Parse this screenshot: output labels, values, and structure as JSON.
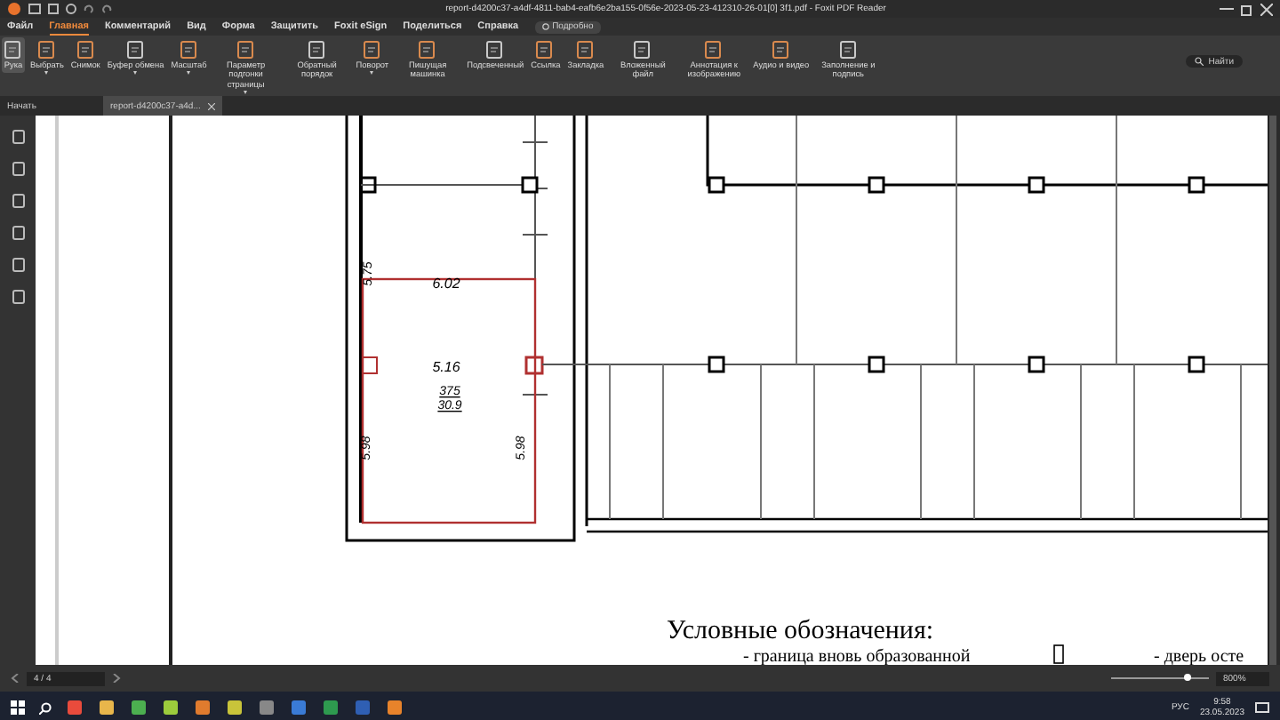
{
  "window": {
    "title": "report-d4200c37-a4df-4811-bab4-eafb6e2ba155-0f56e-2023-05-23-412310-26-01[0] 3f1.pdf - Foxit PDF Reader"
  },
  "menu_tabs": [
    {
      "label": "Файл",
      "selected": false
    },
    {
      "label": "Главная",
      "selected": true
    },
    {
      "label": "Комментарий",
      "selected": false
    },
    {
      "label": "Вид",
      "selected": false
    },
    {
      "label": "Форма",
      "selected": false
    },
    {
      "label": "Защитить",
      "selected": false
    },
    {
      "label": "Foxit eSign",
      "selected": false
    },
    {
      "label": "Поделиться",
      "selected": false
    },
    {
      "label": "Справка",
      "selected": false
    }
  ],
  "tell_me": {
    "placeholder": "Подробно"
  },
  "ribbon": [
    {
      "label": "Рука",
      "dropdown": false,
      "selected": true
    },
    {
      "label": "Выбрать",
      "dropdown": true,
      "selected": false
    },
    {
      "label": "Снимок",
      "dropdown": false,
      "selected": false
    },
    {
      "label": "Буфер обмена",
      "dropdown": true,
      "selected": false
    },
    {
      "label": "Масштаб",
      "dropdown": true,
      "selected": false
    },
    {
      "label": "Параметр подгонки страницы",
      "dropdown": true,
      "selected": false
    },
    {
      "label": "Обратный порядок",
      "dropdown": false,
      "selected": false
    },
    {
      "label": "Поворот",
      "dropdown": true,
      "selected": false
    },
    {
      "label": "Пишущая машинка",
      "dropdown": false,
      "selected": false
    },
    {
      "label": "Подсвеченный",
      "dropdown": false,
      "selected": false
    },
    {
      "label": "Ссылка",
      "dropdown": false,
      "selected": false
    },
    {
      "label": "Закладка",
      "dropdown": false,
      "selected": false
    },
    {
      "label": "Вложенный файл",
      "dropdown": false,
      "selected": false
    },
    {
      "label": "Аннотация к изображению",
      "dropdown": false,
      "selected": false
    },
    {
      "label": "Аудио и видео",
      "dropdown": false,
      "selected": false
    },
    {
      "label": "Заполнение и подпись",
      "dropdown": false,
      "selected": false
    }
  ],
  "find": {
    "placeholder": "Найти"
  },
  "doc_tabs": [
    {
      "label": "Начать",
      "selected": false,
      "closable": false
    },
    {
      "label": "report-d4200c37-a4d...",
      "selected": true,
      "closable": true
    }
  ],
  "plan": {
    "labels": [
      {
        "kind": "vertical",
        "text": "5.75"
      },
      {
        "kind": "horizontal",
        "text": "6.02"
      },
      {
        "kind": "horizontal",
        "text": "5.16"
      },
      {
        "kind": "area",
        "text": "375"
      },
      {
        "kind": "area",
        "text": "30.9"
      },
      {
        "kind": "vertical",
        "text": "5.98"
      },
      {
        "kind": "vertical",
        "text": "5.98"
      }
    ],
    "legend_title": "Условные обозначения:",
    "legend_items": [
      "- граница вновь образованной",
      "- дверь осте"
    ]
  },
  "status_bar": {
    "page": "4 / 4",
    "zoom_slider": {
      "level": 0.78
    },
    "zoom": "800%"
  },
  "taskbar": {
    "time": "9:58",
    "date": "23.05.2023",
    "language": "РУС"
  }
}
